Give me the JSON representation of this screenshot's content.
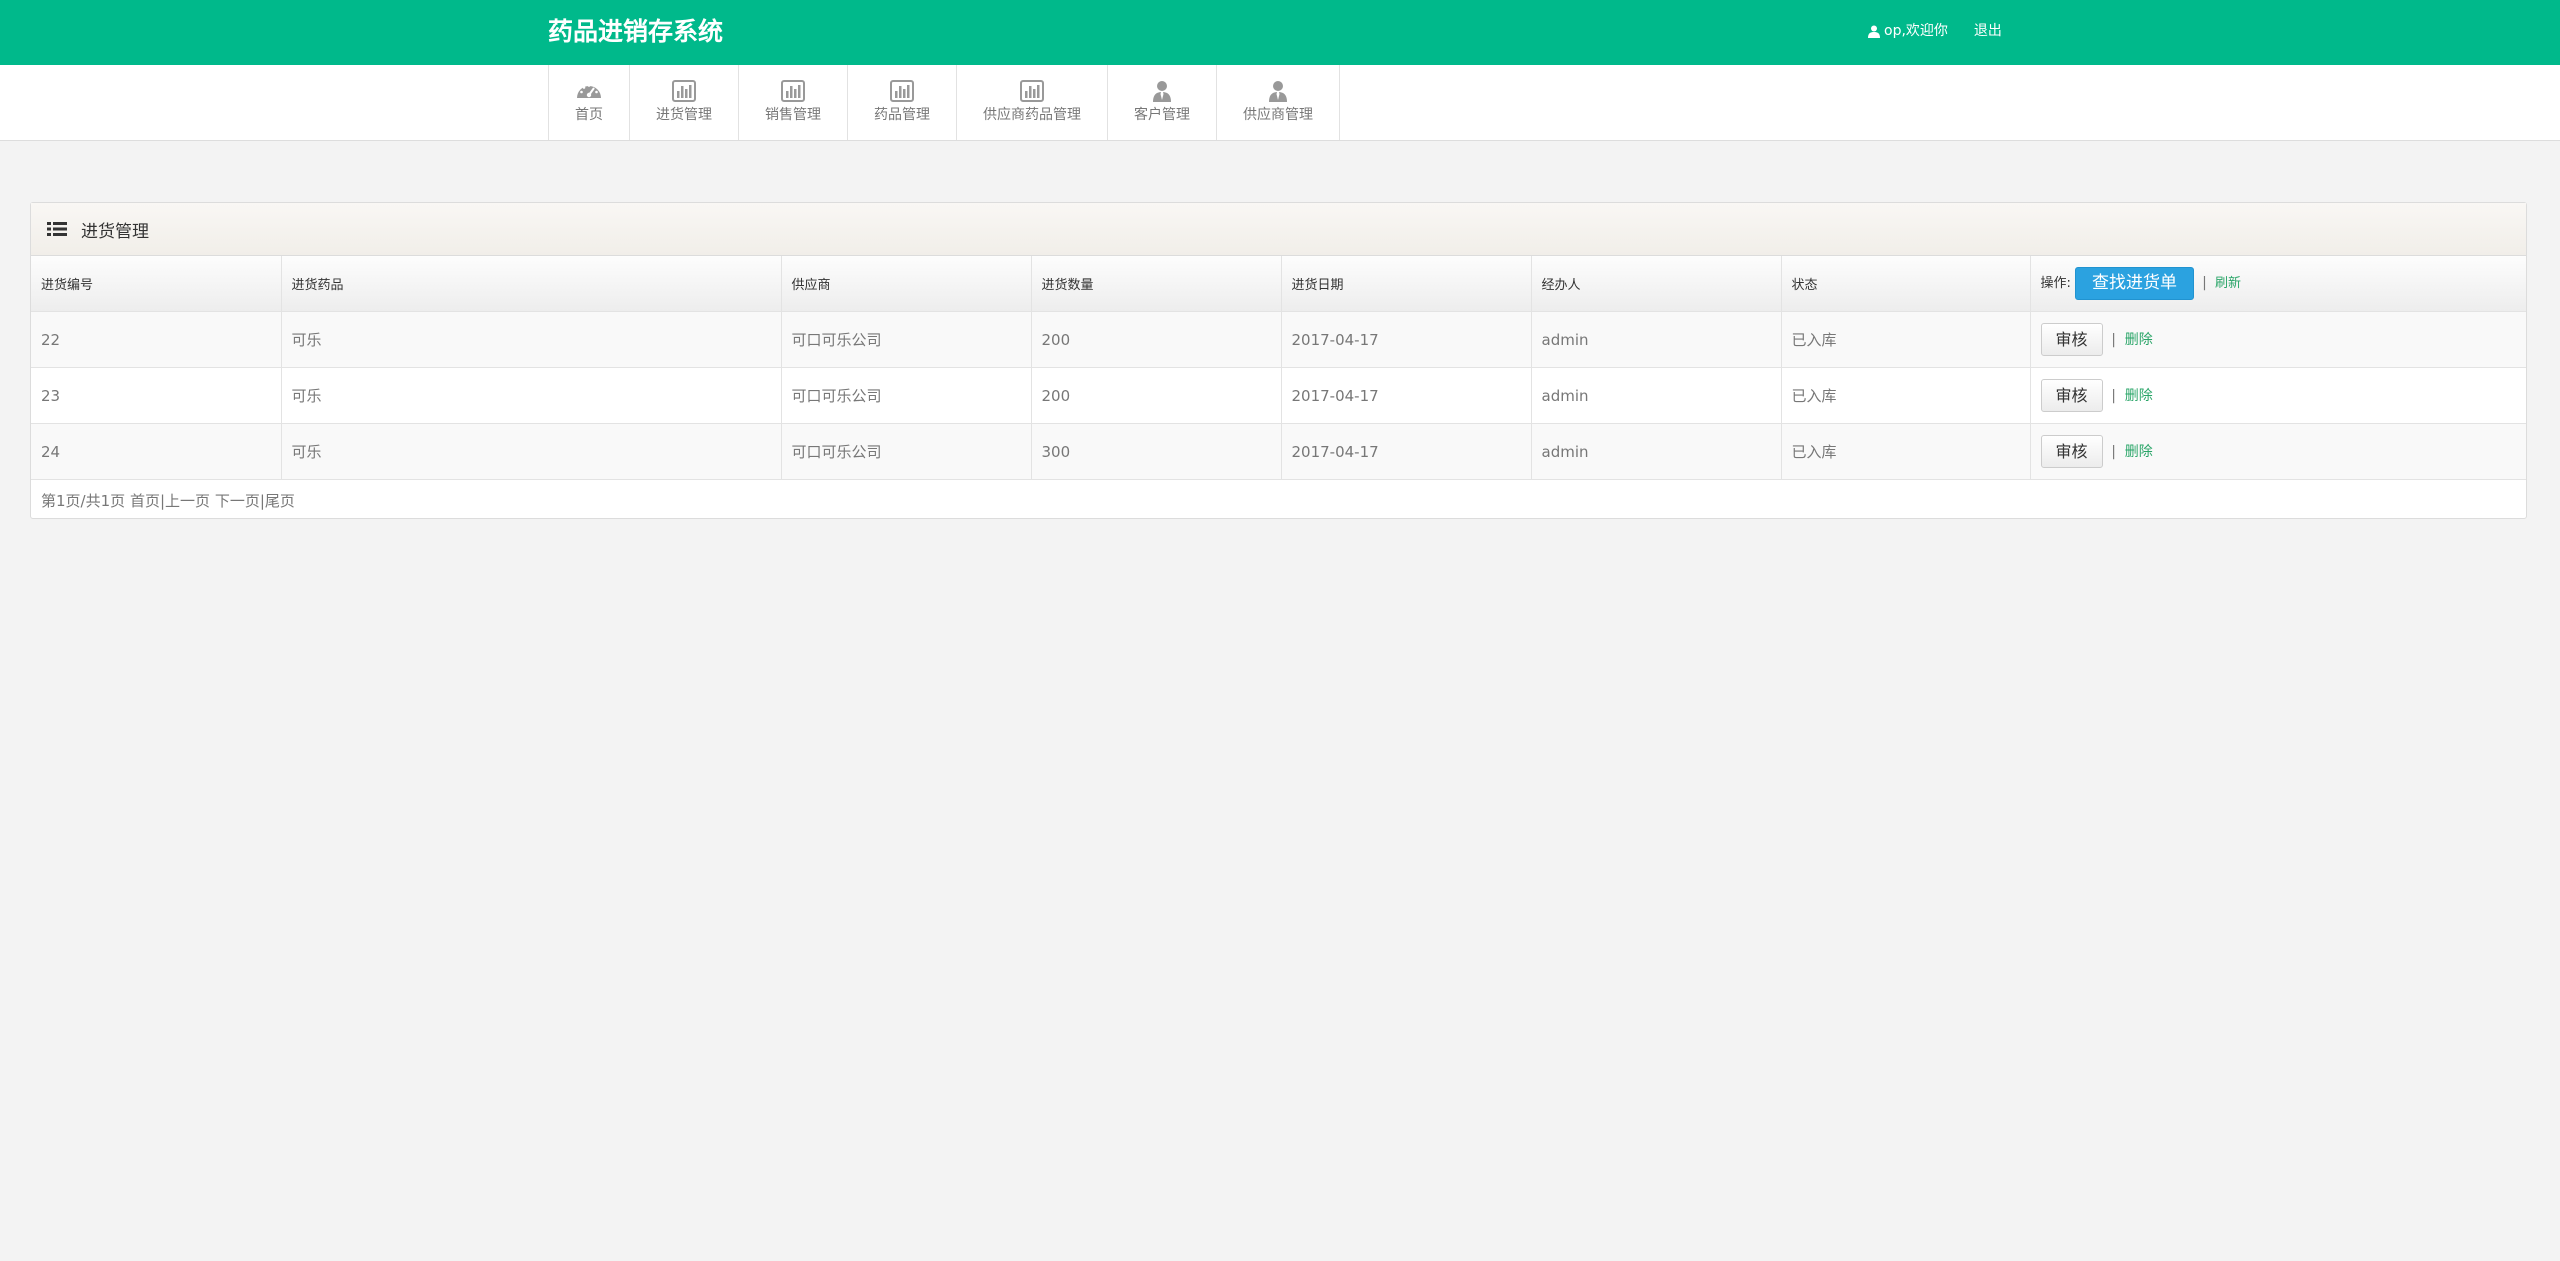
{
  "header": {
    "brand": "药品进销存系统",
    "user_text": "op,欢迎你",
    "logout": "退出"
  },
  "nav": [
    {
      "label": "首页",
      "icon": "dashboard-icon"
    },
    {
      "label": "进货管理",
      "icon": "bar-chart-icon"
    },
    {
      "label": "销售管理",
      "icon": "bar-chart-icon"
    },
    {
      "label": "药品管理",
      "icon": "bar-chart-icon"
    },
    {
      "label": "供应商药品管理",
      "icon": "bar-chart-icon"
    },
    {
      "label": "客户管理",
      "icon": "user-tie-icon"
    },
    {
      "label": "供应商管理",
      "icon": "user-tie-icon"
    }
  ],
  "panel": {
    "title": "进货管理",
    "columns": [
      "进货编号",
      "进货药品",
      "供应商",
      "进货数量",
      "进货日期",
      "经办人",
      "状态"
    ],
    "action_label": "操作:",
    "find_button": "查找进货单",
    "separator": "|",
    "refresh_link": "刷新",
    "rows": [
      {
        "id": "22",
        "drug": "可乐",
        "supplier": "可口可乐公司",
        "qty": "200",
        "date": "2017-04-17",
        "handler": "admin",
        "status": "已入库",
        "audit": "审核",
        "del": "删除"
      },
      {
        "id": "23",
        "drug": "可乐",
        "supplier": "可口可乐公司",
        "qty": "200",
        "date": "2017-04-17",
        "handler": "admin",
        "status": "已入库",
        "audit": "审核",
        "del": "删除"
      },
      {
        "id": "24",
        "drug": "可乐",
        "supplier": "可口可乐公司",
        "qty": "300",
        "date": "2017-04-17",
        "handler": "admin",
        "status": "已入库",
        "audit": "审核",
        "del": "删除"
      }
    ],
    "pager": {
      "info": "第1页/共1页",
      "first": "首页",
      "prev": "上一页",
      "next": "下一页",
      "last": "尾页"
    }
  },
  "colors": {
    "header_green": "#00b98b",
    "find_blue": "#2ba2e0",
    "link_green": "#2aa568"
  }
}
